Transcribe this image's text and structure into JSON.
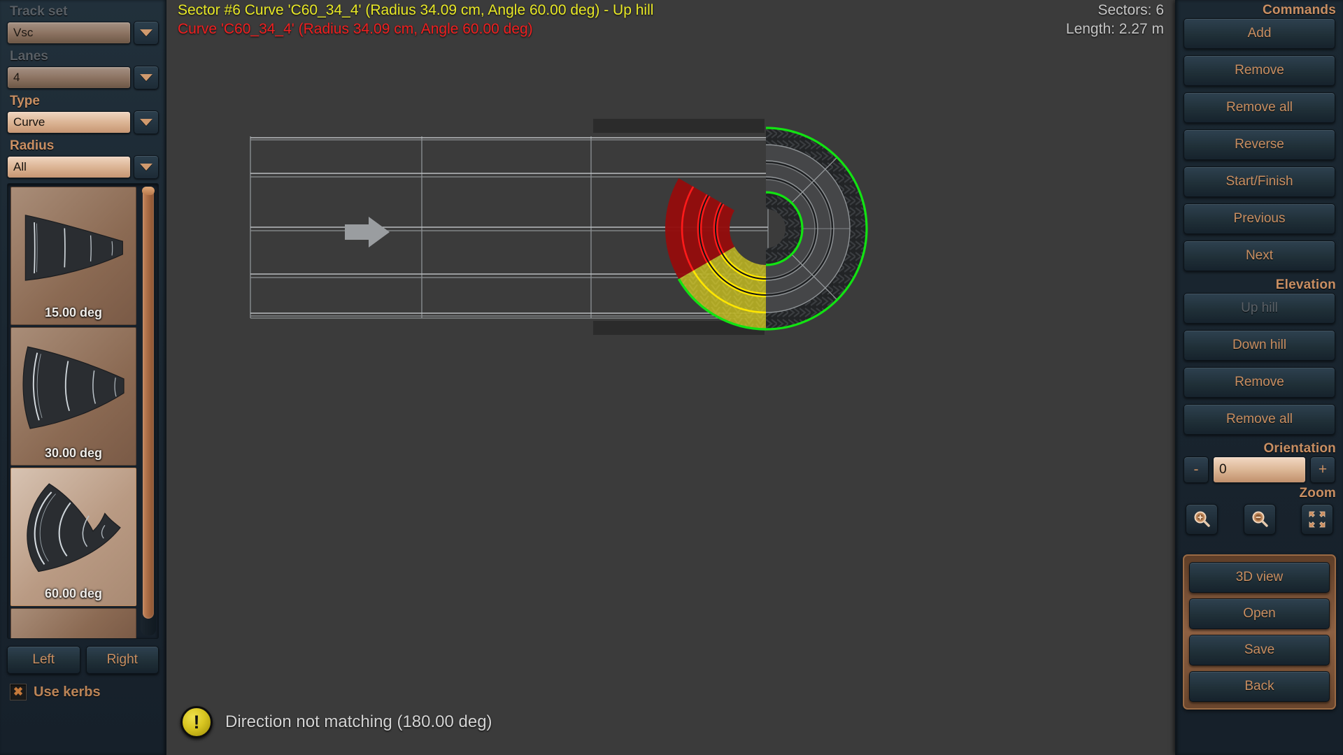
{
  "sidebar": {
    "track_set": {
      "label": "Track set",
      "value": "Vsc",
      "caret": "chevron-down-icon"
    },
    "lanes": {
      "label": "Lanes",
      "value": "4"
    },
    "type": {
      "label": "Type",
      "value": "Curve"
    },
    "radius": {
      "label": "Radius",
      "value": "All"
    },
    "pieces": [
      {
        "label": "15.00 deg",
        "angle": 15,
        "selected": false
      },
      {
        "label": "30.00 deg",
        "angle": 30,
        "selected": false
      },
      {
        "label": "60.00 deg",
        "angle": 60,
        "selected": true
      }
    ],
    "side_buttons": [
      {
        "label": "Left"
      },
      {
        "label": "Right"
      }
    ],
    "use_kerbs": {
      "label": "Use kerbs",
      "checked": true,
      "mark": "✖"
    }
  },
  "canvas": {
    "status_line_1": "Sector #6 Curve 'C60_34_4' (Radius 34.09 cm, Angle 60.00 deg) - Up hill",
    "status_line_2": "Curve 'C60_34_4' (Radius 34.09 cm, Angle 60.00 deg)",
    "sectors": "Sectors: 6",
    "length": "Length: 2.27 m",
    "warning": "Direction not matching (180.00 deg)",
    "warning_icon": "warning-icon",
    "colors": {
      "status_primary": "#e8e827",
      "status_error": "#ef2020",
      "track_outline": "#12e312",
      "ghost_valid": "#b5ad22",
      "ghost_invalid": "#c01010",
      "background": "#3b3b3b"
    }
  },
  "right_panel": {
    "commands": {
      "title": "Commands",
      "buttons": [
        {
          "label": "Add",
          "disabled": false
        },
        {
          "label": "Remove",
          "disabled": false
        },
        {
          "label": "Remove all",
          "disabled": false
        },
        {
          "label": "Reverse",
          "disabled": false
        },
        {
          "label": "Start/Finish",
          "disabled": false
        },
        {
          "label": "Previous",
          "disabled": false
        },
        {
          "label": "Next",
          "disabled": false
        }
      ]
    },
    "elevation": {
      "title": "Elevation",
      "buttons": [
        {
          "label": "Up hill",
          "disabled": true
        },
        {
          "label": "Down hill",
          "disabled": false
        },
        {
          "label": "Remove",
          "disabled": false
        },
        {
          "label": "Remove all",
          "disabled": false
        }
      ]
    },
    "orientation": {
      "title": "Orientation",
      "minus": "-",
      "value": "0",
      "plus": "+"
    },
    "zoom": {
      "title": "Zoom",
      "buttons": [
        {
          "icon": "zoom-in-icon"
        },
        {
          "icon": "zoom-out-icon"
        },
        {
          "icon": "zoom-fit-icon"
        }
      ]
    },
    "actions": [
      {
        "label": "3D view"
      },
      {
        "label": "Open"
      },
      {
        "label": "Save"
      },
      {
        "label": "Back"
      }
    ]
  }
}
